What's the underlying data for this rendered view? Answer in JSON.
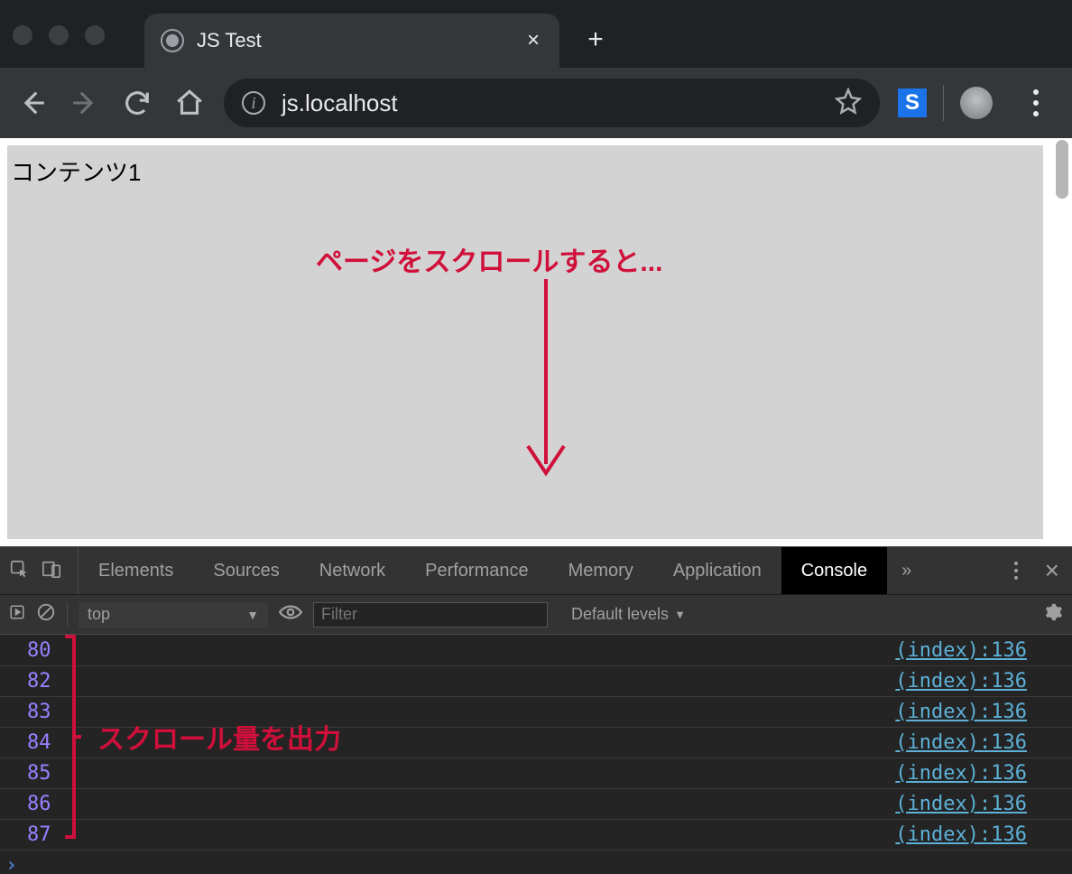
{
  "window": {
    "tab_title": "JS Test",
    "url": "js.localhost"
  },
  "page": {
    "content_heading": "コンテンツ1"
  },
  "annotations": {
    "scroll_note": "ページをスクロールすると...",
    "output_note": "スクロール量を出力"
  },
  "devtools": {
    "tabs": [
      "Elements",
      "Sources",
      "Network",
      "Performance",
      "Memory",
      "Application",
      "Console"
    ],
    "active_tab": "Console",
    "overflow": "»",
    "toolbar": {
      "context": "top",
      "filter_placeholder": "Filter",
      "levels_label": "Default levels"
    },
    "console_logs": [
      {
        "value": "80",
        "source": "(index):136"
      },
      {
        "value": "82",
        "source": "(index):136"
      },
      {
        "value": "83",
        "source": "(index):136"
      },
      {
        "value": "84",
        "source": "(index):136"
      },
      {
        "value": "85",
        "source": "(index):136"
      },
      {
        "value": "86",
        "source": "(index):136"
      },
      {
        "value": "87",
        "source": "(index):136"
      }
    ]
  },
  "ext_letter": "S"
}
